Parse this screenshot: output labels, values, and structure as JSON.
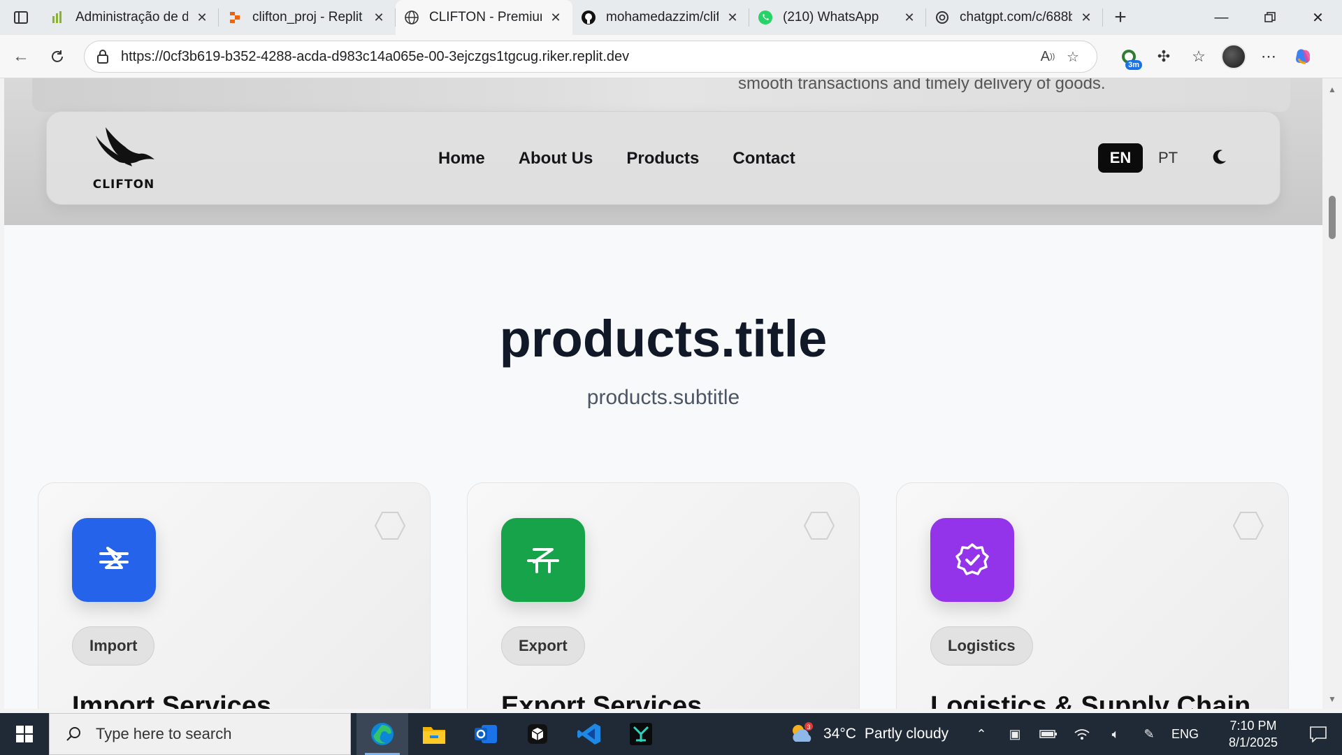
{
  "browser": {
    "tabs": [
      {
        "title": "Administração de do",
        "icon": "chart-bars-icon",
        "active": false
      },
      {
        "title": "clifton_proj - Replit",
        "icon": "replit-icon",
        "active": false
      },
      {
        "title": "CLIFTON - Premium",
        "icon": "globe-icon",
        "active": true
      },
      {
        "title": "mohamedazzim/clift",
        "icon": "github-icon",
        "active": false
      },
      {
        "title": "(210) WhatsApp",
        "icon": "whatsapp-icon",
        "active": false
      },
      {
        "title": "chatgpt.com/c/688b",
        "icon": "openai-icon",
        "active": false
      }
    ],
    "url": "https://0cf3b619-b352-4288-acda-d983c14a065e-00-3ejczgs1tgcug.riker.replit.dev",
    "extension_badge": "3m"
  },
  "site": {
    "hero_text": "smooth transactions and timely delivery of goods.",
    "logo_text": "CLIFTON",
    "nav": [
      "Home",
      "About Us",
      "Products",
      "Contact"
    ],
    "lang_active": "EN",
    "lang_other": "PT",
    "products_title": "products.title",
    "products_subtitle": "products.subtitle",
    "cards": [
      {
        "tag": "Import",
        "title": "Import Services",
        "color": "#2563eb",
        "icon": "import-icon"
      },
      {
        "tag": "Export",
        "title": "Export Services",
        "color": "#16a34a",
        "icon": "export-icon"
      },
      {
        "tag": "Logistics",
        "title": "Logistics & Supply Chain",
        "color": "#9333ea",
        "icon": "badge-check-icon"
      }
    ]
  },
  "taskbar": {
    "search_placeholder": "Type here to search",
    "weather_temp": "34°C",
    "weather_desc": "Partly cloudy",
    "weather_badge": "3",
    "language": "ENG",
    "time": "7:10 PM",
    "date": "8/1/2025"
  }
}
